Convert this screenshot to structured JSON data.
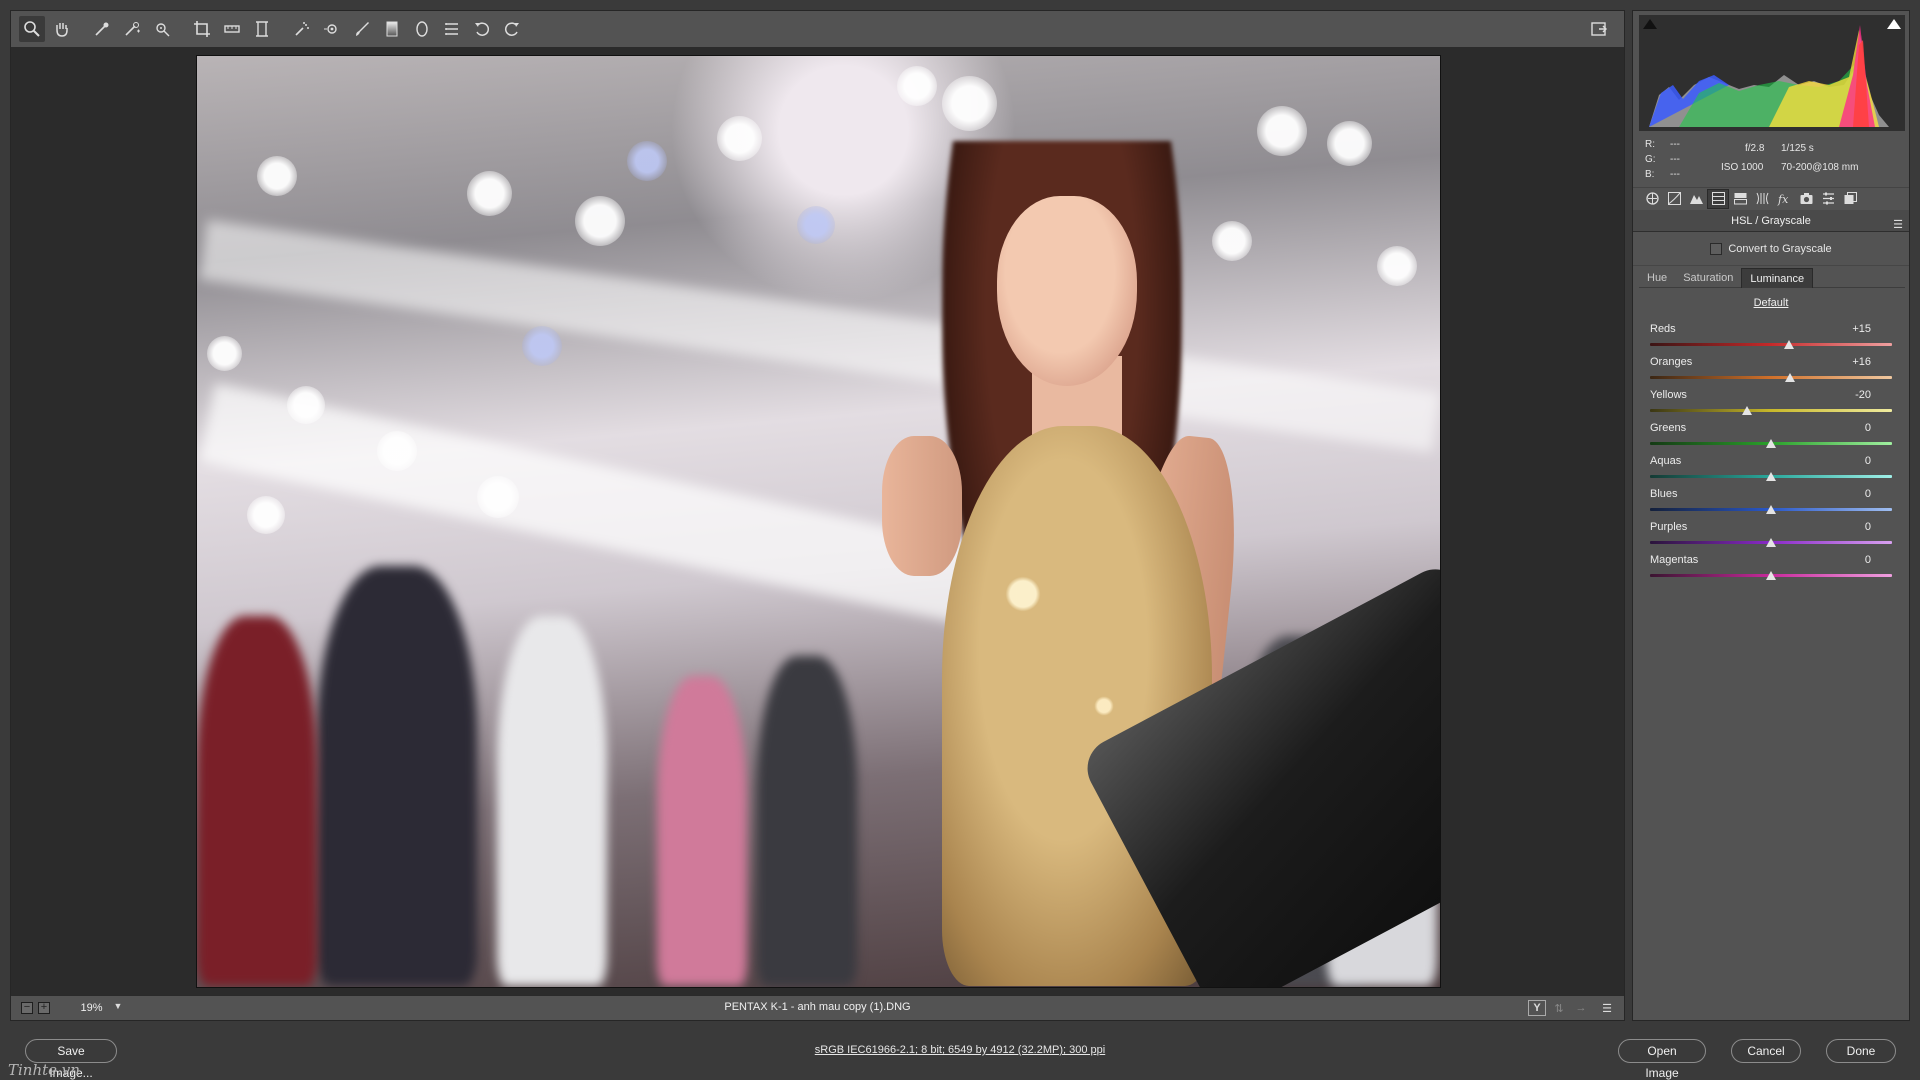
{
  "toolbar": {
    "tools": [
      "zoom-tool",
      "hand-tool",
      "white-balance-tool",
      "color-sampler-tool",
      "targeted-adjustment-tool",
      "crop-tool",
      "straighten-tool",
      "transform-tool",
      "spot-removal-tool",
      "red-eye-removal-tool",
      "adjustment-brush-tool",
      "graduated-filter-tool",
      "radial-filter-tool",
      "preferences-tool",
      "rotate-left-tool",
      "rotate-right-tool"
    ],
    "active_tool": "zoom-tool"
  },
  "viewer": {
    "zoom": "19%",
    "file_name": "PENTAX K-1  -  anh mau copy (1).DNG"
  },
  "readout": {
    "r_label": "R:",
    "g_label": "G:",
    "b_label": "B:",
    "r_value": "---",
    "g_value": "---",
    "b_value": "---",
    "aperture": "f/2.8",
    "shutter": "1/125 s",
    "iso": "ISO 1000",
    "lens": "70-200@108 mm"
  },
  "panel": {
    "title": "HSL / Grayscale",
    "menu_icon": "panel-menu-icon",
    "convert_label": "Convert to Grayscale",
    "convert_checked": false,
    "subtabs": [
      "Hue",
      "Saturation",
      "Luminance"
    ],
    "active_subtab": "Luminance",
    "default_label": "Default",
    "sliders": [
      {
        "name": "reds",
        "label": "Reds",
        "value": "+15",
        "level": 15,
        "track": "linear-gradient(90deg,#3a1414,#c52a2a,#f0a0a0)"
      },
      {
        "name": "oranges",
        "label": "Oranges",
        "value": "+16",
        "level": 16,
        "track": "linear-gradient(90deg,#3a2614,#d0702a,#f0c8a0)"
      },
      {
        "name": "yellows",
        "label": "Yellows",
        "value": "-20",
        "level": -20,
        "track": "linear-gradient(90deg,#3a3614,#c8b82a,#f0eca0)"
      },
      {
        "name": "greens",
        "label": "Greens",
        "value": "0",
        "level": 0,
        "track": "linear-gradient(90deg,#143a14,#2aa02a,#a0f0a0)"
      },
      {
        "name": "aquas",
        "label": "Aquas",
        "value": "0",
        "level": 0,
        "track": "linear-gradient(90deg,#143a34,#2aa89c,#a0f0e8)"
      },
      {
        "name": "blues",
        "label": "Blues",
        "value": "0",
        "level": 0,
        "track": "linear-gradient(90deg,#14203a,#2a58c8,#a0bef0)"
      },
      {
        "name": "purples",
        "label": "Purples",
        "value": "0",
        "level": 0,
        "track": "linear-gradient(90deg,#2a143a,#8a2ac8,#d8a0f0)"
      },
      {
        "name": "magentas",
        "label": "Magentas",
        "value": "0",
        "level": 0,
        "track": "linear-gradient(90deg,#3a1430,#c82a9c,#f0a0e0)"
      }
    ]
  },
  "bottom": {
    "save_label": "Save Image...",
    "workflow_text": "sRGB IEC61966-2.1; 8 bit; 6549 by 4912 (32.2MP); 300 ppi",
    "open_label": "Open Image",
    "cancel_label": "Cancel",
    "done_label": "Done",
    "watermark": "Tinhte.vn"
  },
  "colors": {
    "panel_bg": "#535353",
    "app_bg": "#3a3a3a",
    "canvas_bg": "#2b2b2b"
  }
}
